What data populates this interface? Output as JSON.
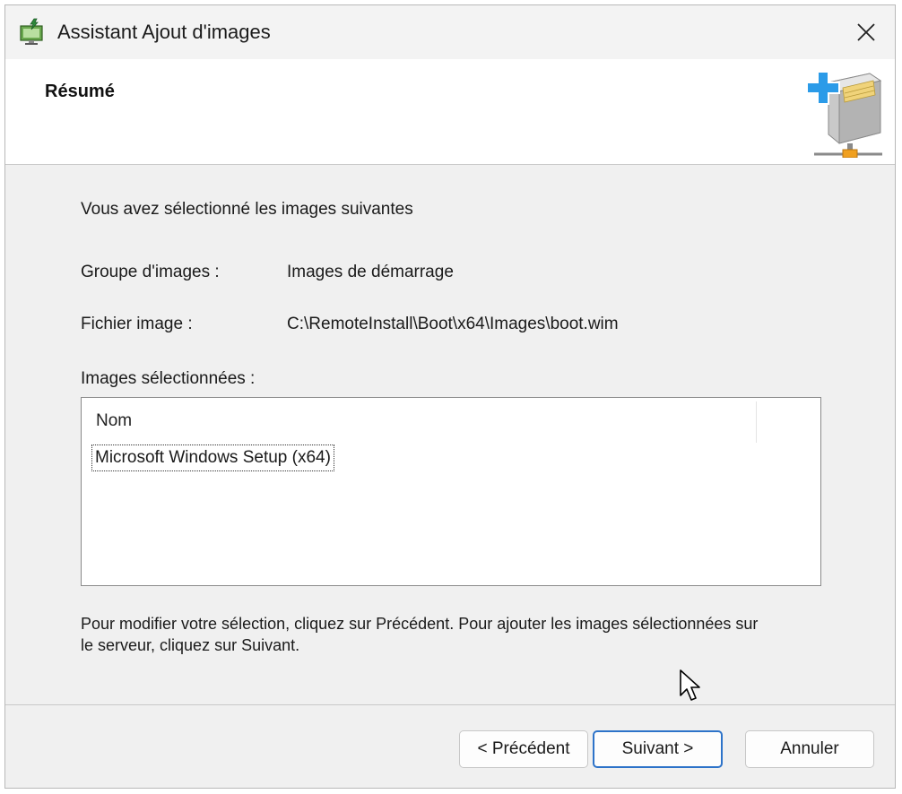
{
  "window": {
    "title": "Assistant Ajout d'images"
  },
  "header": {
    "title": "Résumé"
  },
  "summary": {
    "intro": "Vous avez sélectionné les images suivantes",
    "group_label": "Groupe d'images :",
    "group_value": "Images de démarrage",
    "file_label": "Fichier image :",
    "file_value": "C:\\RemoteInstall\\Boot\\x64\\Images\\boot.wim",
    "list_label": "Images sélectionnées :",
    "list_column": "Nom",
    "list_items": [
      "Microsoft Windows Setup (x64)"
    ],
    "info": "Pour modifier votre sélection, cliquez sur Précédent. Pour ajouter les images sélectionnées sur le serveur, cliquez sur Suivant."
  },
  "buttons": {
    "prev": "< Précédent",
    "next": "Suivant >",
    "cancel": "Annuler"
  },
  "colors": {
    "accent": "#2d73c9",
    "window_bg": "#f0f0f0"
  },
  "icons": {
    "app": "monitor-download-icon",
    "close": "close-icon",
    "header": "add-image-box-icon",
    "cursor": "mouse-pointer-icon"
  }
}
